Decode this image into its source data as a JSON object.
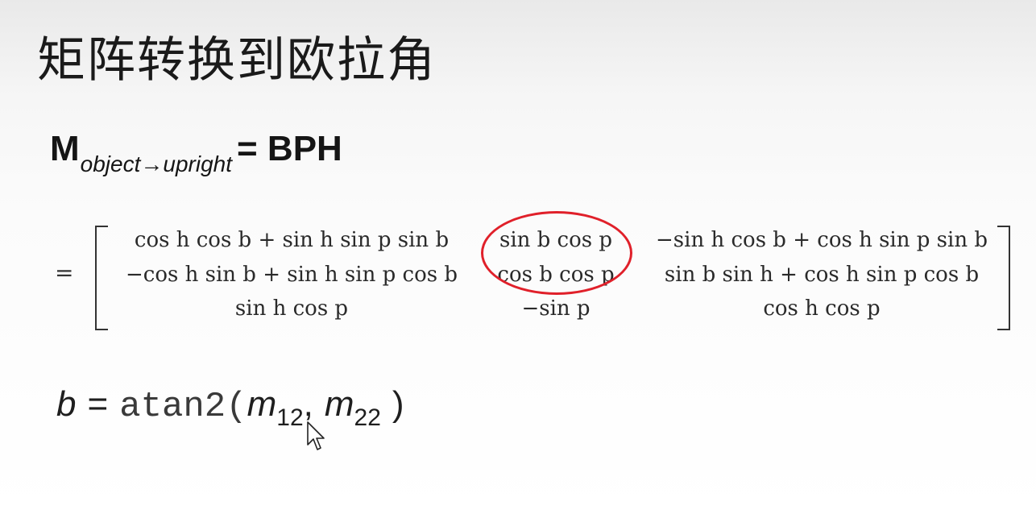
{
  "slide": {
    "title": "矩阵转换到欧拉角",
    "main_equation": {
      "lhs": "M",
      "subscript": "object→upright",
      "rhs": "= BPH"
    },
    "matrix": {
      "equals": "=",
      "rows": [
        [
          "cos h cos b + sin h sin p sin b",
          "sin b cos p",
          "−sin h cos b + cos h sin p sin b"
        ],
        [
          "−cos h sin b + sin h sin p cos b",
          "cos b cos p",
          "sin b sin h + cos h sin p cos b"
        ],
        [
          "sin h cos p",
          "−sin p",
          "cos h cos p"
        ]
      ],
      "highlight_color": "#e0202a"
    },
    "formula": {
      "var": "b",
      "eq": "=",
      "fn": "atan2(",
      "arg1": "m",
      "arg1_sub": "12",
      "sep": ",",
      "arg2": "m",
      "arg2_sub": "22",
      "close": ")"
    },
    "icons": {
      "cursor": "mouse-pointer-icon",
      "highlight": "red-ellipse"
    }
  }
}
